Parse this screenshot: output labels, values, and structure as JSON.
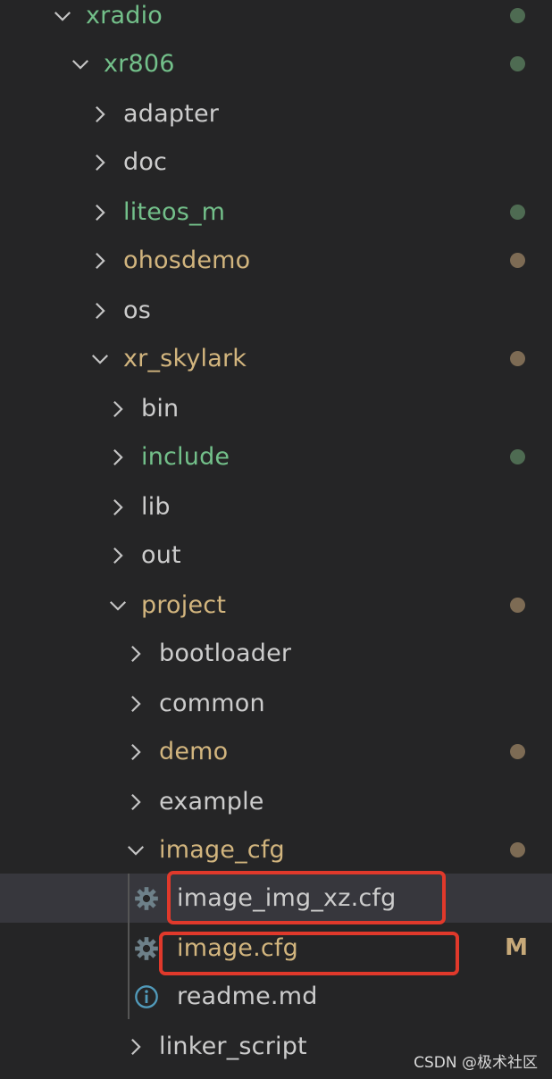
{
  "explorer": {
    "rows": [
      {
        "label": "xradio",
        "level": 0,
        "kind": "folder",
        "open": true,
        "color": "green",
        "status": "green-dot"
      },
      {
        "label": "xr806",
        "level": 1,
        "kind": "folder",
        "open": true,
        "color": "green",
        "status": "green-dot"
      },
      {
        "label": "adapter",
        "level": 2,
        "kind": "folder",
        "open": false,
        "color": "default"
      },
      {
        "label": "doc",
        "level": 2,
        "kind": "folder",
        "open": false,
        "color": "default"
      },
      {
        "label": "liteos_m",
        "level": 2,
        "kind": "folder",
        "open": false,
        "color": "green",
        "status": "green-dot"
      },
      {
        "label": "ohosdemo",
        "level": 2,
        "kind": "folder",
        "open": false,
        "color": "yellow",
        "status": "yellow-dot"
      },
      {
        "label": "os",
        "level": 2,
        "kind": "folder",
        "open": false,
        "color": "default"
      },
      {
        "label": "xr_skylark",
        "level": 2,
        "kind": "folder",
        "open": true,
        "color": "yellow",
        "status": "yellow-dot"
      },
      {
        "label": "bin",
        "level": 3,
        "kind": "folder",
        "open": false,
        "color": "default"
      },
      {
        "label": "include",
        "level": 3,
        "kind": "folder",
        "open": false,
        "color": "green",
        "status": "green-dot"
      },
      {
        "label": "lib",
        "level": 3,
        "kind": "folder",
        "open": false,
        "color": "default"
      },
      {
        "label": "out",
        "level": 3,
        "kind": "folder",
        "open": false,
        "color": "default"
      },
      {
        "label": "project",
        "level": 3,
        "kind": "folder",
        "open": true,
        "color": "yellow",
        "status": "yellow-dot"
      },
      {
        "label": "bootloader",
        "level": 4,
        "kind": "folder",
        "open": false,
        "color": "default"
      },
      {
        "label": "common",
        "level": 4,
        "kind": "folder",
        "open": false,
        "color": "default"
      },
      {
        "label": "demo",
        "level": 4,
        "kind": "folder",
        "open": false,
        "color": "yellow",
        "status": "yellow-dot"
      },
      {
        "label": "example",
        "level": 4,
        "kind": "folder",
        "open": false,
        "color": "default"
      },
      {
        "label": "image_cfg",
        "level": 4,
        "kind": "folder",
        "open": true,
        "color": "yellow",
        "status": "yellow-dot"
      },
      {
        "label": "image_img_xz.cfg",
        "level": 5,
        "kind": "file",
        "icon": "gear-icon",
        "color": "default",
        "selected": true
      },
      {
        "label": "image.cfg",
        "level": 5,
        "kind": "file",
        "icon": "gear-icon",
        "color": "yellow",
        "badge": "M"
      },
      {
        "label": "readme.md",
        "level": 5,
        "kind": "file",
        "icon": "info-icon",
        "color": "default"
      },
      {
        "label": "linker_script",
        "level": 4,
        "kind": "folder",
        "open": false,
        "color": "default"
      }
    ]
  },
  "colors": {
    "background": "#252526",
    "selected": "#37373d",
    "highlight_box": "#e0392b",
    "green": "#73c08a",
    "yellow": "#d2b57e"
  },
  "watermark": "CSDN @极术社区"
}
